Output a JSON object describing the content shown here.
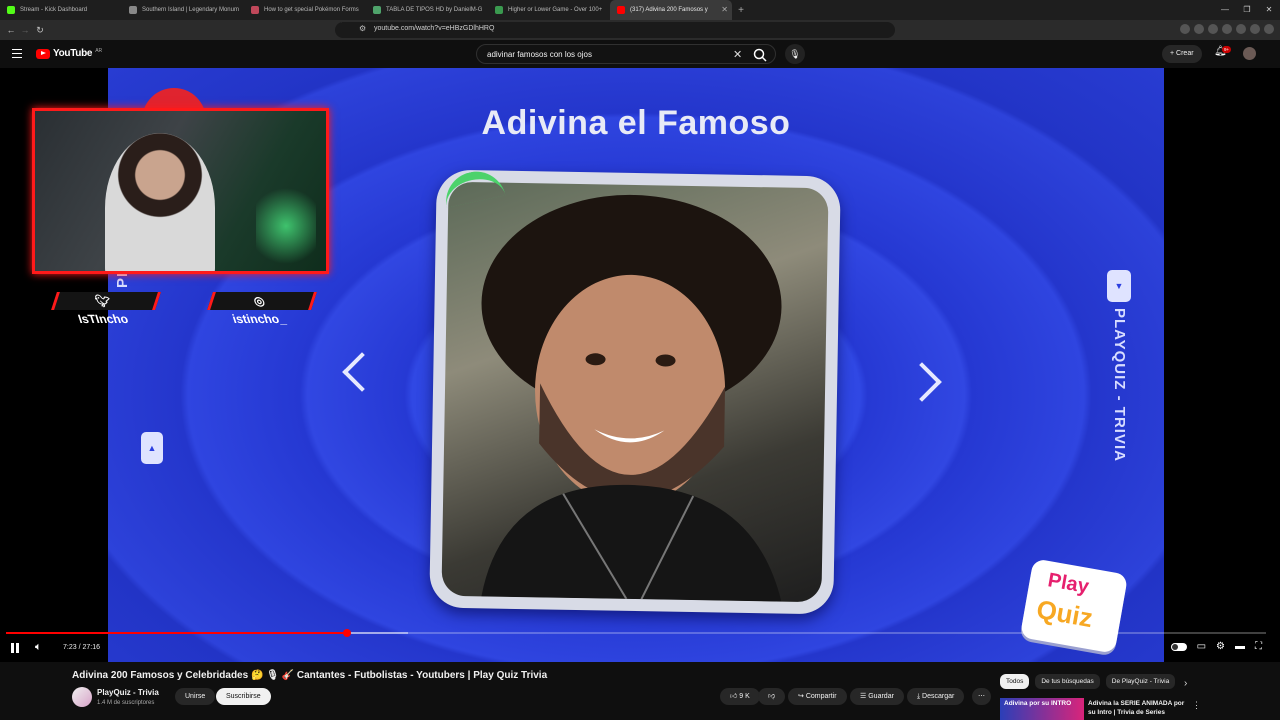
{
  "browser": {
    "tabs": [
      {
        "label": "Stream - Kick Dashboard",
        "color": "#53fc18"
      },
      {
        "label": "Southern Island | Legendary Monum",
        "color": "#888888"
      },
      {
        "label": "How to get special Pokémon Forms",
        "color": "#c0485a"
      },
      {
        "label": "TABLA DE TIPOS HD by DanielM-G",
        "color": "#4fa36b"
      },
      {
        "label": "Higher or Lower Game - Over 100+",
        "color": "#3a9a4f"
      },
      {
        "label": "(317) Adivina 200 Famosos y",
        "color": "#ff0000",
        "active": true
      }
    ],
    "url": "youtube.com/watch?v=eHBzGDlhHRQ"
  },
  "youtube": {
    "logo_text": "YouTube",
    "country": "AR",
    "search_query": "adivinar famosos con los ojos",
    "create_label": "Crear",
    "notif_count": "9+"
  },
  "video_frame": {
    "title": "Adivina el Famoso",
    "side_label": "PLAYQUIZ - TRIVIA",
    "logo_play": "Play",
    "logo_quiz": "Quiz",
    "social_twitter": "IsTIncho",
    "social_instagram": "istincho_"
  },
  "player": {
    "time_current": "7:23",
    "time_total": "27:16",
    "time_display": "7:23 / 27:16",
    "played_fraction": 0.271,
    "buffered_fraction": 0.319
  },
  "video_info": {
    "title": "Adivina 200 Famosos y Celebridades 🤔 🎙 🎸 Cantantes - Futbolistas - Youtubers | Play Quiz Trivia",
    "channel_name": "PlayQuiz - Trivia",
    "subscribers": "1.4 M de suscriptores",
    "join_label": "Unirse",
    "subscribe_label": "Suscribirse",
    "likes": "9 K",
    "share_label": "Compartir",
    "save_label": "Guardar",
    "download_label": "Descargar"
  },
  "recommendations": {
    "chips": [
      "Todos",
      "De tus búsquedas",
      "De PlayQuiz - Trivia"
    ],
    "first_thumb_text": "Adivina por su INTRO",
    "first_title": "Adivina la SERIE ANIMADA por su Intro | Trivia de Series"
  }
}
